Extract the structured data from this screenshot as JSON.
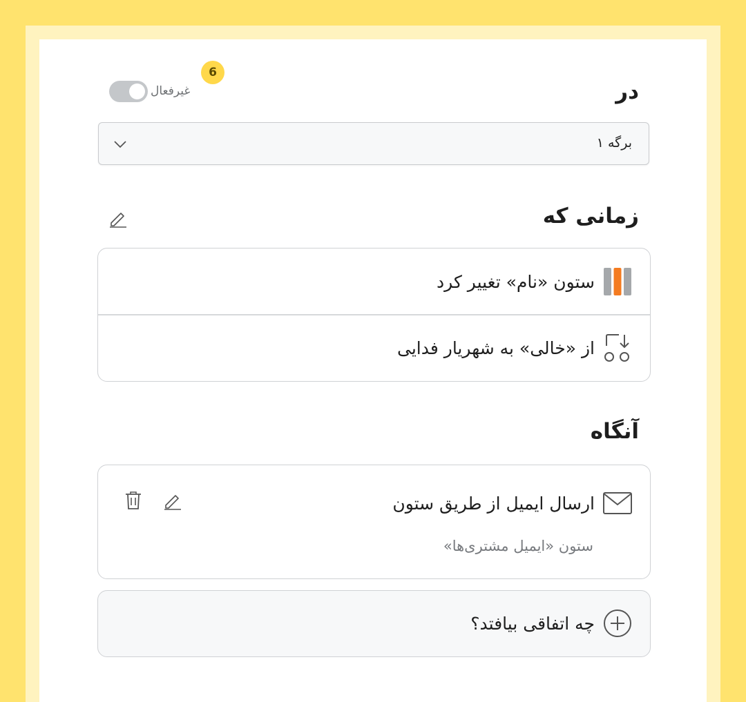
{
  "trigger": {
    "title": "در",
    "toggle_label": "غیرفعال",
    "toggle_on": false,
    "badge_count": "6",
    "sheet_select": {
      "selected": "برگه ۱"
    }
  },
  "when": {
    "title": "زمانی که",
    "rows": [
      {
        "text": "ستون «نام» تغییر کرد",
        "icon": "columns-icon"
      },
      {
        "text": "از «خالی» به شهریار فدایی",
        "icon": "value-change-icon"
      }
    ]
  },
  "then": {
    "title": "آنگاه",
    "action": {
      "title": "ارسال ایمیل از طریق ستون",
      "subtitle": "ستون «ایمیل مشتری‌ها»",
      "icon": "envelope-icon"
    },
    "add_action_label": "چه اتفاقی بیافتد؟"
  },
  "colors": {
    "accent_orange": "#f47b20",
    "badge_yellow": "#ffd84a",
    "frame_yellow": "#ffe36e"
  }
}
